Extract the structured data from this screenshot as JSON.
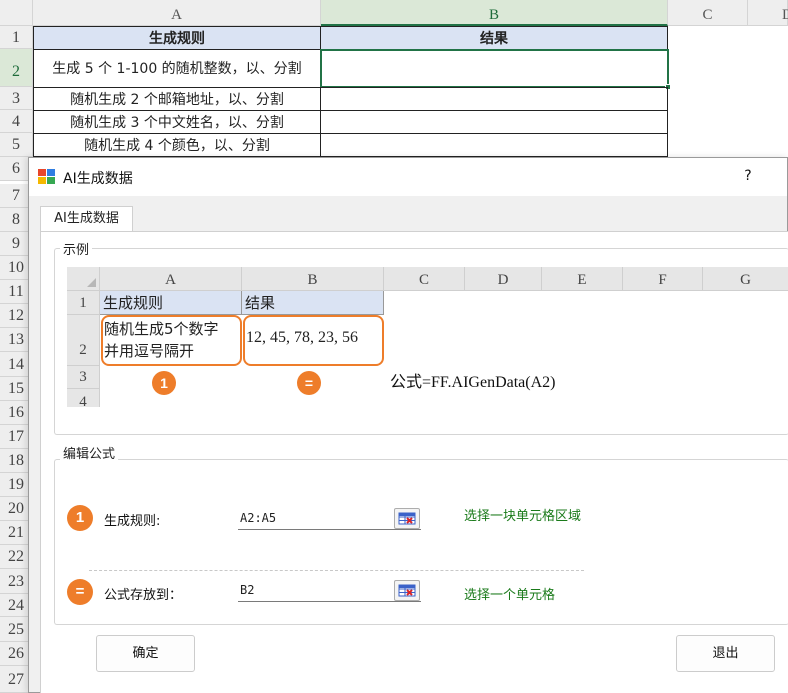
{
  "sheet": {
    "columns": [
      "A",
      "B",
      "C",
      "D"
    ],
    "rows": [
      "1",
      "2",
      "3",
      "4",
      "5",
      "6",
      "7",
      "8",
      "9",
      "10",
      "11",
      "12",
      "13",
      "14",
      "15",
      "16",
      "17",
      "18",
      "19",
      "20",
      "21",
      "22",
      "23",
      "24",
      "25",
      "26",
      "27"
    ],
    "header": {
      "rule": "生成规则",
      "result": "结果"
    },
    "rules": [
      "生成 5 个 1-100 的随机整数，以、分割",
      "随机生成 2 个邮箱地址，以、分割",
      "随机生成 3 个中文姓名，以、分割",
      "随机生成 4 个颜色，以、分割"
    ]
  },
  "dialog": {
    "title": "AI生成数据",
    "help": "?",
    "tab": "AI生成数据",
    "example": {
      "group_label": "示例",
      "columns": [
        "A",
        "B",
        "C",
        "D",
        "E",
        "F",
        "G"
      ],
      "rows": [
        "1",
        "2",
        "3",
        "4"
      ],
      "header_rule": "生成规则",
      "header_result": "结果",
      "rule_line1": "随机生成5个数字",
      "rule_line2": "并用逗号隔开",
      "result": "12, 45, 78, 23, 56",
      "badge_rule": "1",
      "badge_result": "=",
      "formula": "公式=FF.AIGenData(A2)"
    },
    "edit": {
      "group_label": "编辑公式",
      "rule_badge": "1",
      "rule_label": "生成规则:",
      "rule_value": "A2:A5",
      "rule_hint": "选择一块单元格区域",
      "target_badge": "=",
      "target_label": "公式存放到：",
      "target_value": "B2",
      "target_hint": "选择一个单元格"
    },
    "ok": "确定",
    "cancel": "退出"
  },
  "colors": {
    "accent_orange": "#ee7d2a",
    "hint_green": "#1a7a1a",
    "header_blue": "#dae3f3",
    "excel_green": "#217346"
  },
  "icons": {
    "app": "app-grid-icon",
    "picker": "cell-range-picker-icon"
  }
}
